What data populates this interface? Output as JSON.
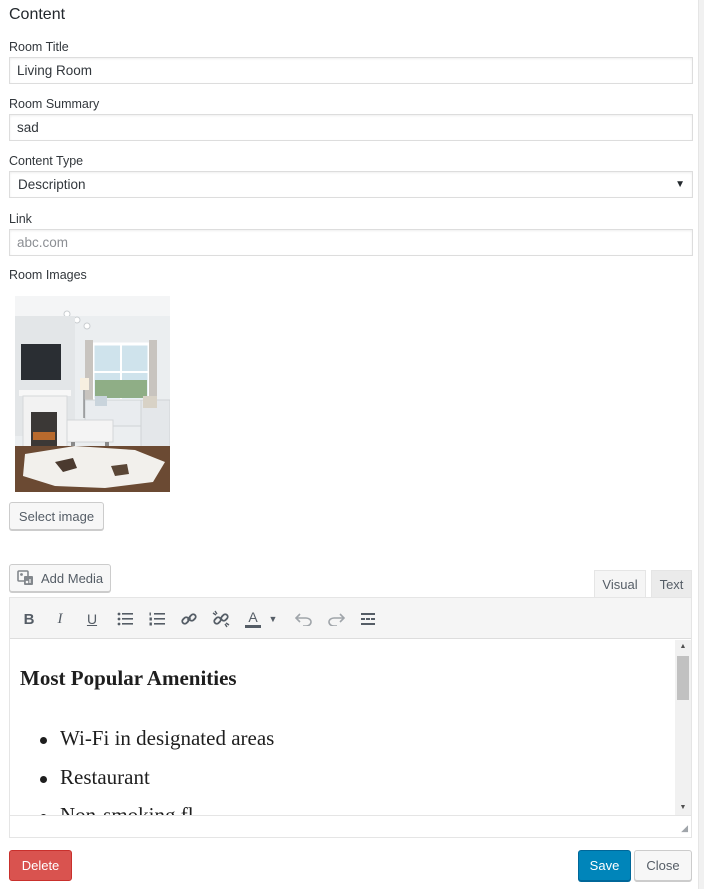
{
  "section": {
    "title": "Content"
  },
  "fields": {
    "room_title": {
      "label": "Room Title",
      "value": "Living Room"
    },
    "room_summary": {
      "label": "Room Summary",
      "value": "sad"
    },
    "content_type": {
      "label": "Content Type",
      "value": "Description"
    },
    "link": {
      "label": "Link",
      "placeholder": "abc.com"
    },
    "room_images": {
      "label": "Room Images"
    }
  },
  "buttons": {
    "select_image": "Select image",
    "add_media": "Add Media",
    "delete": "Delete",
    "save": "Save",
    "close": "Close"
  },
  "editor": {
    "tabs": [
      "Visual",
      "Text"
    ],
    "active_tab": "Visual",
    "toolbar": [
      "bold-icon",
      "italic-icon",
      "underline-icon",
      "bulleted-list-icon",
      "numbered-list-icon",
      "insert-link-icon",
      "remove-link-icon",
      "text-color-icon",
      "undo-icon",
      "redo-icon",
      "toolbar-toggle-icon"
    ],
    "content": {
      "heading": "Most Popular Amenities",
      "items": [
        "Wi-Fi in designated areas",
        "Restaurant",
        "Non-smoking fl..."
      ]
    }
  },
  "colors": {
    "delete": "#d9534f",
    "save": "#0085ba",
    "border": "#dddddd"
  }
}
